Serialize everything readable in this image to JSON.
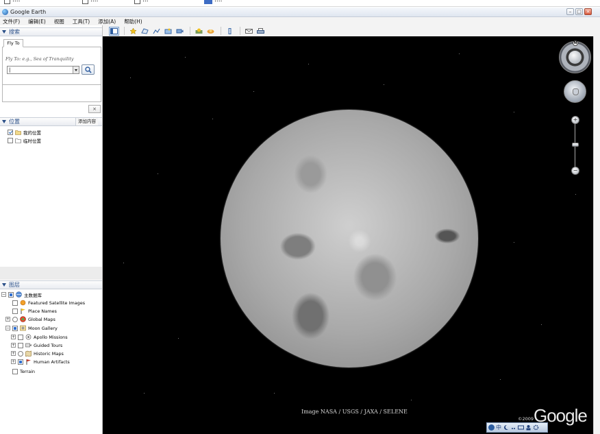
{
  "taskbar_strip": {
    "items": [
      {
        "label": "...."
      },
      {
        "label": "...."
      },
      {
        "label": "..."
      },
      {
        "label": "...."
      }
    ]
  },
  "window": {
    "title": "Google Earth",
    "controls": {
      "minimize": "–",
      "maximize": "□",
      "close": "×"
    }
  },
  "menubar": {
    "items": [
      "文件(F)",
      "编辑(E)",
      "视图",
      "工具(T)",
      "添加(A)",
      "帮助(H)"
    ]
  },
  "toolbar": {
    "buttons": [
      "sidebar-icon",
      "placemark-icon",
      "polygon-icon",
      "path-icon",
      "image-overlay-icon",
      "tour-icon",
      "historical-imagery-icon",
      "sun-icon",
      "planets-icon",
      "ruler-icon",
      "email-icon",
      "print-icon"
    ]
  },
  "search": {
    "header": "搜索",
    "tab_label": "Fly To",
    "hint": "Fly To: e.g., Sea of Tranquility",
    "input_value": "|",
    "clear_label": "×"
  },
  "places": {
    "header": "位置",
    "add_content_label": "添加内容",
    "items": [
      {
        "label": "我的位置",
        "checked": true
      },
      {
        "label": "临时位置",
        "checked": false
      }
    ]
  },
  "layers": {
    "header": "图层",
    "root_label": "主数据库",
    "items": [
      {
        "label": "Featured Satellite Images"
      },
      {
        "label": "Place Names"
      },
      {
        "label": "Global Maps"
      },
      {
        "label": "Moon Gallery"
      },
      {
        "label": "Apollo Missions"
      },
      {
        "label": "Guided Tours"
      },
      {
        "label": "Historic Maps"
      },
      {
        "label": "Human Artifacts"
      },
      {
        "label": "Terrain"
      }
    ]
  },
  "map": {
    "credit": "Image NASA / USGS / JAXA / SELENE",
    "copyright": "©2009",
    "logo": "Google",
    "compass_north": "N",
    "zoom_in": "+",
    "zoom_out": "−"
  },
  "ime": {
    "label": "中"
  }
}
